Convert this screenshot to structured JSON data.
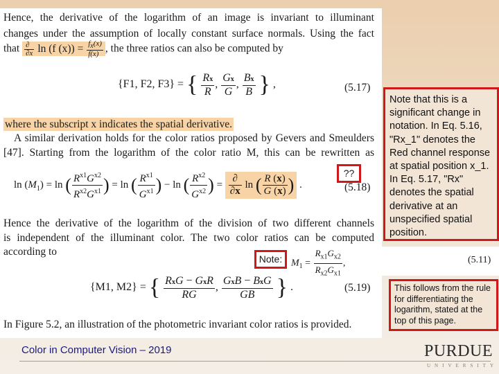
{
  "document": {
    "para1": {
      "line1": "Hence, the derivative of the logarithm of an image is invariant to illuminant",
      "line2": "changes under the assumption of locally constant surface normals. Using the fact",
      "line3_pre": "that",
      "line3_formula_lhs": "ln (f (x)) =",
      "line3_post": ", the three ratios can also be computed by"
    },
    "eq517": {
      "lhs": "{F1, F2, F3} =",
      "num": [
        "Rx",
        "Gx",
        "Bx"
      ],
      "den": [
        "R",
        "G",
        "B"
      ],
      "number": "(5.17)"
    },
    "where_line": "where the subscript x indicates the spatial derivative.",
    "para2": {
      "line1": "A similar derivation holds for the color ratios proposed by Gevers and Smeulders",
      "line2": "[47]. Starting from the logarithm of the color ratio M, this can be rewritten as"
    },
    "eq518": {
      "number": "(5.18)"
    },
    "para3": {
      "line1": "Hence the derivative of the logarithm of the division of two different channels",
      "line2": "is independent of the illuminant color. The two color ratios can be computed",
      "line3": "according to"
    },
    "eq511": {
      "number": "(5.11)"
    },
    "eq519": {
      "lhs": "{M1, M2} =",
      "number": "(5.19)"
    },
    "last_line": "In Figure 5.2, an illustration of the photometric invariant color ratios is provided."
  },
  "annotations": {
    "question_marks": "??",
    "note_label": "Note:",
    "note1": "Note that this is a significant change in notation. In Eq. 5.16, \"Rx_1\" denotes the Red channel response at spatial position x_1. In Eq. 5.17, \"Rx\" denotes the spatial derivative at an unspecified spatial position.",
    "note2": "This follows from the rule for differentiating the logarithm, stated at the top of this page."
  },
  "footer": {
    "title": "Color in Computer Vision – 2019",
    "logo_main": "PURDUE",
    "logo_sub": "UNIVERSITY"
  },
  "colors": {
    "highlight": "#f7d3a6",
    "annotation_border": "#d01818",
    "footer_text": "#1a1a7a"
  }
}
